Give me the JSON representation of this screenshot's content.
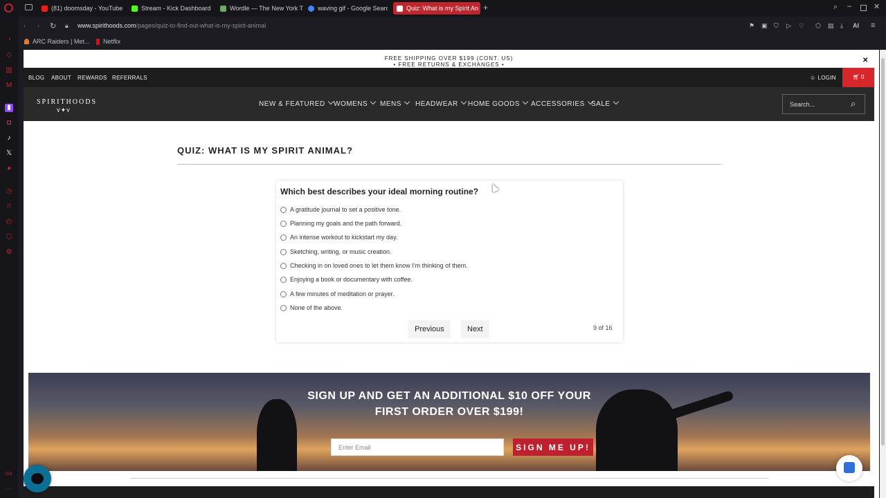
{
  "browser": {
    "tabs": [
      {
        "label": "(81) doomsday - YouTube",
        "color": "#e62117"
      },
      {
        "label": "Stream - Kick Dashboard",
        "color": "#53fc18"
      },
      {
        "label": "Wordle — The New York T",
        "color": "#6aaa64"
      },
      {
        "label": "waving gif - Google Searc",
        "color": "#4285f4"
      },
      {
        "label": "Quiz: What is my Spirit An",
        "color": "#ffffff"
      }
    ],
    "url_domain": "www.spirithoods.com",
    "url_path": "/pages/quiz-to-find-out-what-is-my-spirit-animal",
    "ai_label": "AI",
    "bookmarks": [
      "ARC Raiders | Met...",
      "Netflix"
    ],
    "sidebar_bottom_label": "GX"
  },
  "site": {
    "shipping_line1": "FREE SHIPPING OVER $199 (CONT. US)",
    "shipping_line2": "• FREE RETURNS & EXCHANGES •",
    "top_links": [
      "BLOG",
      "ABOUT",
      "REWARDS",
      "REFERRALS"
    ],
    "login_label": "LOGIN",
    "cart_count": "0",
    "logo": "SPIRITHOODS",
    "nav": [
      "NEW & FEATURED",
      "WOMENS",
      "MENS",
      "HEADWEAR",
      "HOME GOODS",
      "ACCESSORIES",
      "SALE"
    ],
    "search_placeholder": "Search...",
    "accent_color": "#d7272b"
  },
  "quiz": {
    "title": "QUIZ: WHAT IS MY SPIRIT ANIMAL?",
    "question": "Which best describes your ideal morning routine?",
    "options": [
      "A gratitude journal to set a positive tone.",
      "Planning my goals and the path forward.",
      "An intense workout to kickstart my day.",
      "Sketching, writing, or music creation.",
      "Checking in on loved ones to let them know I’m thinking of them.",
      "Enjoying a book or documentary with coffee.",
      "A few minutes of meditation or prayer.",
      "None of the above."
    ],
    "previous_label": "Previous",
    "next_label": "Next",
    "progress": "9 of 16"
  },
  "promo": {
    "headline_line1": "SIGN UP AND GET AN ADDITIONAL $10 OFF YOUR",
    "headline_line2": "FIRST ORDER OVER $199!",
    "email_placeholder": "Enter Email",
    "button_label": "SIGN ME UP!"
  }
}
